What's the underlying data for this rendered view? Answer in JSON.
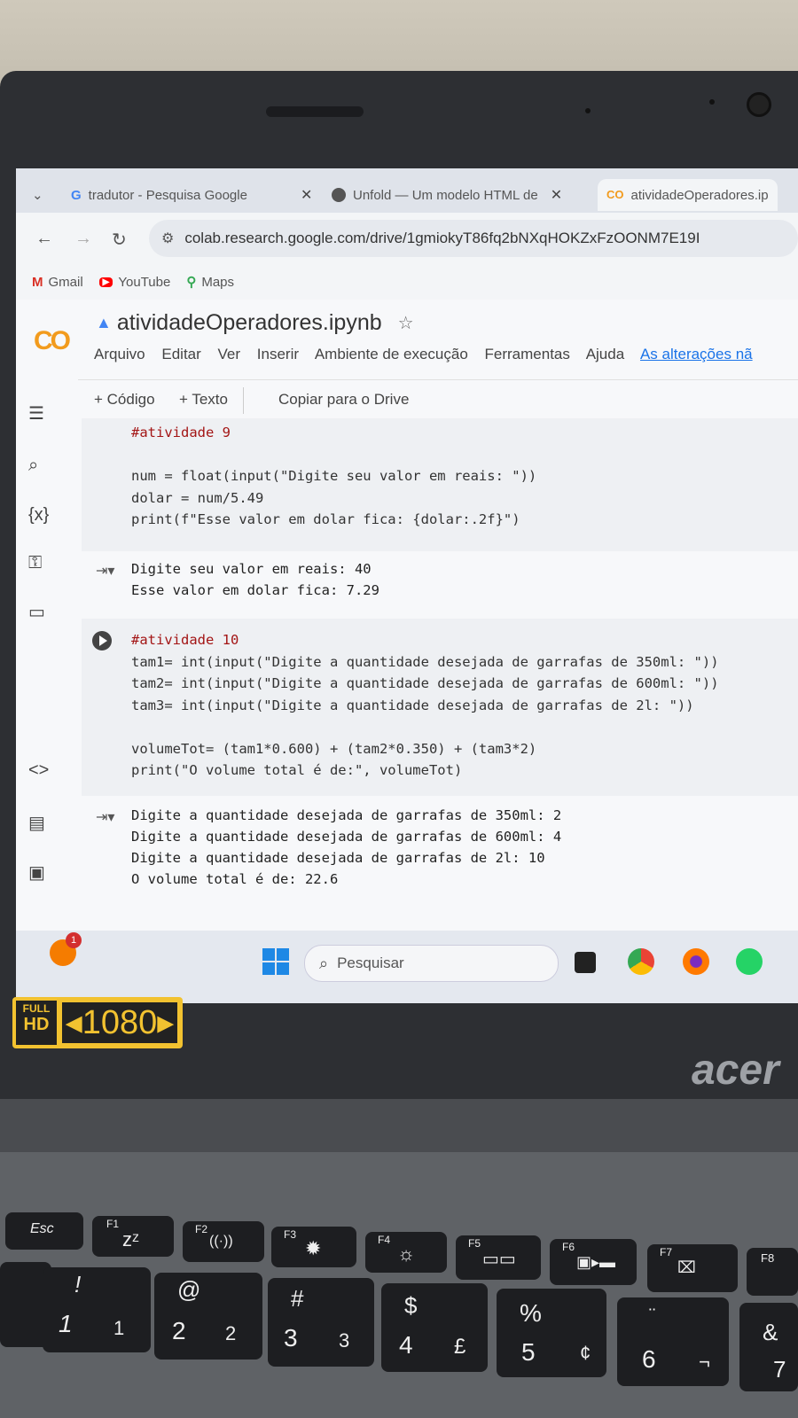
{
  "tabs": [
    {
      "label": "tradutor - Pesquisa Google",
      "icon": "google-icon"
    },
    {
      "label": "Unfold — Um modelo HTML de",
      "icon": "globe-icon"
    },
    {
      "label": "atividadeOperadores.ip",
      "icon": "colab-icon"
    }
  ],
  "address": {
    "url": "colab.research.google.com/drive/1gmiokyT86fq2bNXqHOKZxFzOONM7E19I"
  },
  "bookmarks": [
    {
      "label": "Gmail"
    },
    {
      "label": "YouTube"
    },
    {
      "label": "Maps"
    }
  ],
  "notebook": {
    "logo": "CO",
    "title": "atividadeOperadores.ipynb",
    "menu": [
      "Arquivo",
      "Editar",
      "Ver",
      "Inserir",
      "Ambiente de execução",
      "Ferramentas",
      "Ajuda"
    ],
    "status_link": "As alterações nã",
    "toolbar": {
      "add_code": "+ Código",
      "add_text": "+ Texto",
      "copy_drive": "Copiar para o Drive"
    }
  },
  "cells": [
    {
      "exec": "[ ]",
      "lines": [
        "#atividade 9",
        "",
        "num = float(input(\"Digite seu valor em reais: \"))",
        "dolar = num/5.49",
        "print(f\"Esse valor em dolar fica: {dolar:.2f}\")"
      ],
      "output": [
        "Digite seu valor em reais: 40",
        "Esse valor em dolar fica: 7.29"
      ]
    },
    {
      "exec": "run",
      "lines": [
        "#atividade 10",
        "tam1= int(input(\"Digite a quantidade desejada de garrafas de 350ml: \"))",
        "tam2= int(input(\"Digite a quantidade desejada de garrafas de 600ml: \"))",
        "tam3= int(input(\"Digite a quantidade desejada de garrafas de 2l: \"))",
        "",
        "volumeTot= (tam1*0.600) + (tam2*0.350) + (tam3*2)",
        "print(\"O volume total é de:\", volumeTot)"
      ],
      "output": [
        "Digite a quantidade desejada de garrafas de 350ml: 2",
        "Digite a quantidade desejada de garrafas de 600ml: 4",
        "Digite a quantidade desejada de garrafas de 2l: 10",
        "O volume total é de: 22.6"
      ]
    }
  ],
  "taskbar": {
    "search_placeholder": "Pesquisar",
    "notification_count": "1"
  },
  "sticker": {
    "top": "FULL",
    "bottom": "HD",
    "resolution": "◂1080▸"
  },
  "brand": "acer",
  "keys": [
    "Esc",
    "F1",
    "F2",
    "F3",
    "F4",
    "F5",
    "F6",
    "F7",
    "F8",
    "!",
    "1",
    "@",
    "2",
    "#",
    "3",
    "$",
    "4",
    "%",
    "5",
    "6",
    "&",
    "£",
    "¢",
    "¬"
  ]
}
